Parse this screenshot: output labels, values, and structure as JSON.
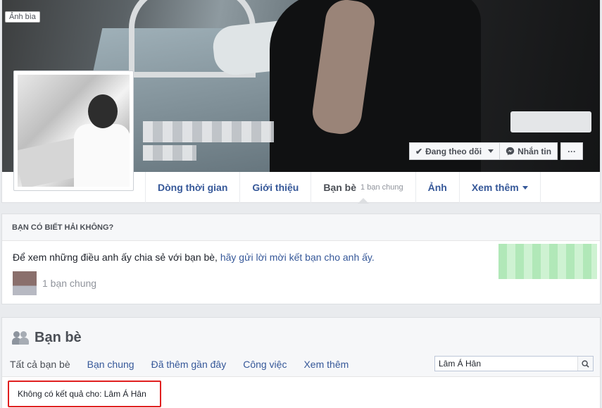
{
  "cover": {
    "label": "Ảnh bìa"
  },
  "actions": {
    "following": "Đang theo dõi",
    "message": "Nhắn tin",
    "more": "···"
  },
  "profile_tabs": [
    {
      "label": "Dòng thời gian"
    },
    {
      "label": "Giới thiệu"
    },
    {
      "label": "Bạn bè",
      "sub": "1 bạn chung"
    },
    {
      "label": "Ảnh"
    },
    {
      "label": "Xem thêm"
    }
  ],
  "know": {
    "heading": "BẠN CÓ BIẾT HẢI KHÔNG?",
    "text_prefix": "Để xem những điều anh ấy chia sẻ với bạn bè, ",
    "text_link": "hãy gửi lời mời kết bạn cho anh ấy.",
    "mutual": "1 bạn chung"
  },
  "friends": {
    "title": "Bạn bè",
    "tabs": [
      "Tất cả bạn bè",
      "Bạn chung",
      "Đã thêm gần đây",
      "Công việc",
      "Xem thêm"
    ],
    "search_value": "Lâm Á Hân",
    "no_result": "Không có kết quả cho: Lâm Á Hân"
  }
}
